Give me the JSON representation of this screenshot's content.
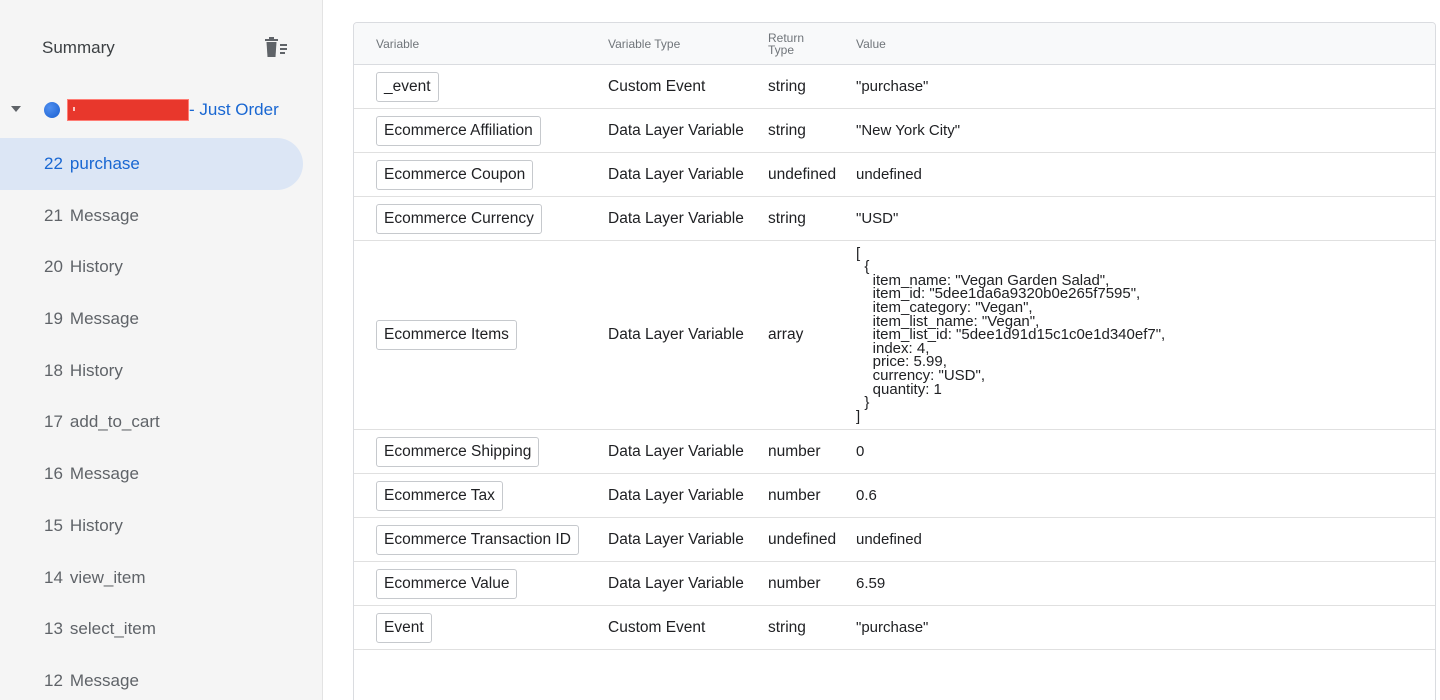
{
  "sidebar": {
    "summary_label": "Summary",
    "container": {
      "name": "- Just Order"
    },
    "events": [
      {
        "num": "22",
        "name": "purchase",
        "selected": true
      },
      {
        "num": "21",
        "name": "Message"
      },
      {
        "num": "20",
        "name": "History"
      },
      {
        "num": "19",
        "name": "Message"
      },
      {
        "num": "18",
        "name": "History"
      },
      {
        "num": "17",
        "name": "add_to_cart"
      },
      {
        "num": "16",
        "name": "Message"
      },
      {
        "num": "15",
        "name": "History"
      },
      {
        "num": "14",
        "name": "view_item"
      },
      {
        "num": "13",
        "name": "select_item"
      },
      {
        "num": "12",
        "name": "Message"
      }
    ]
  },
  "table": {
    "headers": {
      "variable": "Variable",
      "variable_type": "Variable Type",
      "return_type": "Return Type",
      "value": "Value"
    },
    "rows": [
      {
        "variable": "_event",
        "type": "Custom Event",
        "return_type": "string",
        "value": "\"purchase\""
      },
      {
        "variable": "Ecommerce Affiliation",
        "type": "Data Layer Variable",
        "return_type": "string",
        "value": "\"New York City\""
      },
      {
        "variable": "Ecommerce Coupon",
        "type": "Data Layer Variable",
        "return_type": "undefined",
        "value": "undefined"
      },
      {
        "variable": "Ecommerce Currency",
        "type": "Data Layer Variable",
        "return_type": "string",
        "value": "\"USD\""
      },
      {
        "variable": "Ecommerce Items",
        "type": "Data Layer Variable",
        "return_type": "array",
        "value": "[\n  {\n    item_name: \"Vegan Garden Salad\",\n    item_id: \"5dee1da6a9320b0e265f7595\",\n    item_category: \"Vegan\",\n    item_list_name: \"Vegan\",\n    item_list_id: \"5dee1d91d15c1c0e1d340ef7\",\n    index: 4,\n    price: 5.99,\n    currency: \"USD\",\n    quantity: 1\n  }\n]"
      },
      {
        "variable": "Ecommerce Shipping",
        "type": "Data Layer Variable",
        "return_type": "number",
        "value": "0"
      },
      {
        "variable": "Ecommerce Tax",
        "type": "Data Layer Variable",
        "return_type": "number",
        "value": "0.6"
      },
      {
        "variable": "Ecommerce Transaction ID",
        "type": "Data Layer Variable",
        "return_type": "undefined",
        "value": "undefined"
      },
      {
        "variable": "Ecommerce Value",
        "type": "Data Layer Variable",
        "return_type": "number",
        "value": "6.59"
      },
      {
        "variable": "Event",
        "type": "Custom Event",
        "return_type": "string",
        "value": "\"purchase\""
      }
    ]
  },
  "colors": {
    "accent": "#1967d2",
    "selected_bg": "#dce6f5",
    "redaction": "#e8372c"
  }
}
